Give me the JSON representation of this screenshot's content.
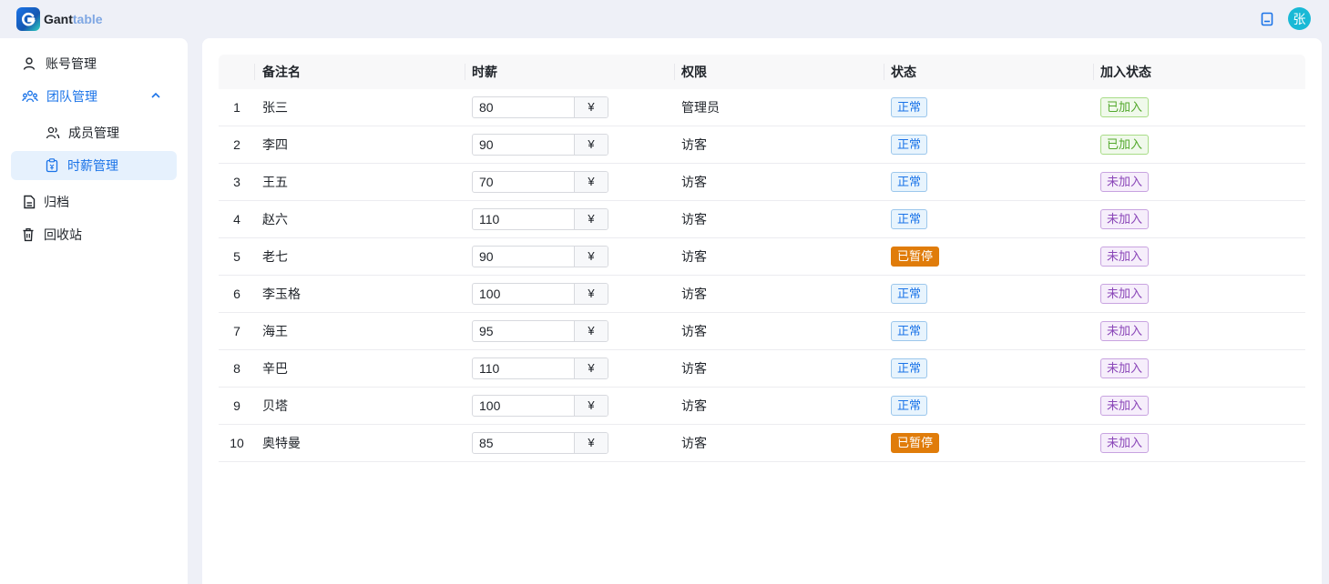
{
  "app": {
    "brand_part1": "Gant",
    "brand_part2": "table",
    "avatar_text": "张"
  },
  "sidebar": {
    "items": [
      {
        "label": "账号管理",
        "icon": "user-icon"
      },
      {
        "label": "团队管理",
        "icon": "team-icon",
        "expanded": true
      },
      {
        "label": "成员管理",
        "icon": "members-icon"
      },
      {
        "label": "时薪管理",
        "icon": "wage-icon",
        "selected": true
      },
      {
        "label": "归档",
        "icon": "archive-icon"
      },
      {
        "label": "回收站",
        "icon": "trash-icon"
      }
    ]
  },
  "table": {
    "headers": {
      "name": "备注名",
      "wage": "时薪",
      "role": "权限",
      "status": "状态",
      "join": "加入状态"
    },
    "currency": "¥",
    "rows": [
      {
        "index": "1",
        "name": "张三",
        "wage": "80",
        "role": "管理员",
        "status": "正常",
        "join": "已加入"
      },
      {
        "index": "2",
        "name": "李四",
        "wage": "90",
        "role": "访客",
        "status": "正常",
        "join": "已加入"
      },
      {
        "index": "3",
        "name": "王五",
        "wage": "70",
        "role": "访客",
        "status": "正常",
        "join": "未加入"
      },
      {
        "index": "4",
        "name": "赵六",
        "wage": "110",
        "role": "访客",
        "status": "正常",
        "join": "未加入"
      },
      {
        "index": "5",
        "name": "老七",
        "wage": "90",
        "role": "访客",
        "status": "已暂停",
        "join": "未加入"
      },
      {
        "index": "6",
        "name": "李玉格",
        "wage": "100",
        "role": "访客",
        "status": "正常",
        "join": "未加入"
      },
      {
        "index": "7",
        "name": "海王",
        "wage": "95",
        "role": "访客",
        "status": "正常",
        "join": "未加入"
      },
      {
        "index": "8",
        "name": "辛巴",
        "wage": "110",
        "role": "访客",
        "status": "正常",
        "join": "未加入"
      },
      {
        "index": "9",
        "name": "贝塔",
        "wage": "100",
        "role": "访客",
        "status": "正常",
        "join": "未加入"
      },
      {
        "index": "10",
        "name": "奥特曼",
        "wage": "85",
        "role": "访客",
        "status": "已暂停",
        "join": "未加入"
      }
    ]
  },
  "colors": {
    "accent": "#1a73e8",
    "paused": "#e07c0a",
    "joined": "#52a82b",
    "notjoined": "#8a46b8",
    "avatar": "#19b9d6"
  }
}
